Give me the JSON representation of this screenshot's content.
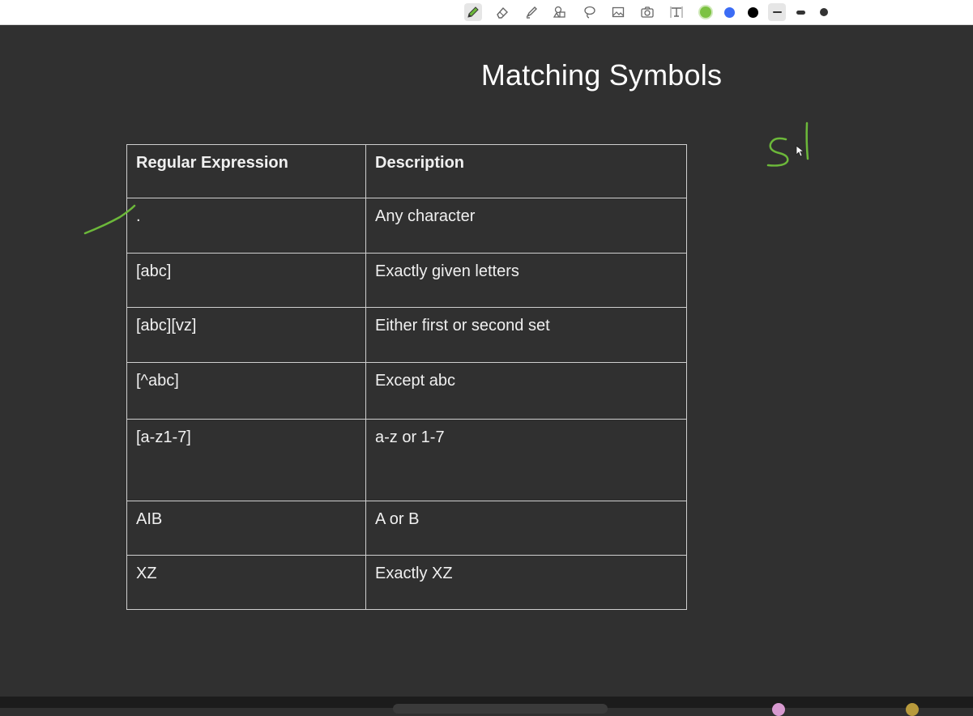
{
  "toolbar": {
    "tools": [
      {
        "icon": "pen-icon"
      },
      {
        "icon": "eraser-icon"
      },
      {
        "icon": "highlighter-icon"
      },
      {
        "icon": "shapes-icon"
      },
      {
        "icon": "lasso-icon"
      },
      {
        "icon": "image-icon"
      },
      {
        "icon": "camera-icon"
      },
      {
        "icon": "text-box-icon"
      }
    ],
    "colors": [
      "#7cc242",
      "#3b6cf5",
      "#000000"
    ],
    "stroke_sizes": [
      "thin",
      "medium",
      "thick"
    ]
  },
  "slide": {
    "title": "Matching Symbols",
    "table": {
      "headers": [
        "Regular Expression",
        "Description"
      ],
      "rows": [
        {
          "expr": ".",
          "desc": "Any character"
        },
        {
          "expr": "[abc]",
          "desc": "Exactly given letters"
        },
        {
          "expr": "[abc][vz]",
          "desc": "Either first or second set"
        },
        {
          "expr": "[^abc]",
          "desc": "Except abc"
        },
        {
          "expr": "[a-z1-7]",
          "desc": "a-z or 1-7"
        },
        {
          "expr": "AIB",
          "desc": "A or B"
        },
        {
          "expr": "XZ",
          "desc": "Exactly XZ"
        }
      ]
    }
  },
  "annotations": {
    "ink_color": "#6cb83a",
    "handwriting": "Sl"
  }
}
